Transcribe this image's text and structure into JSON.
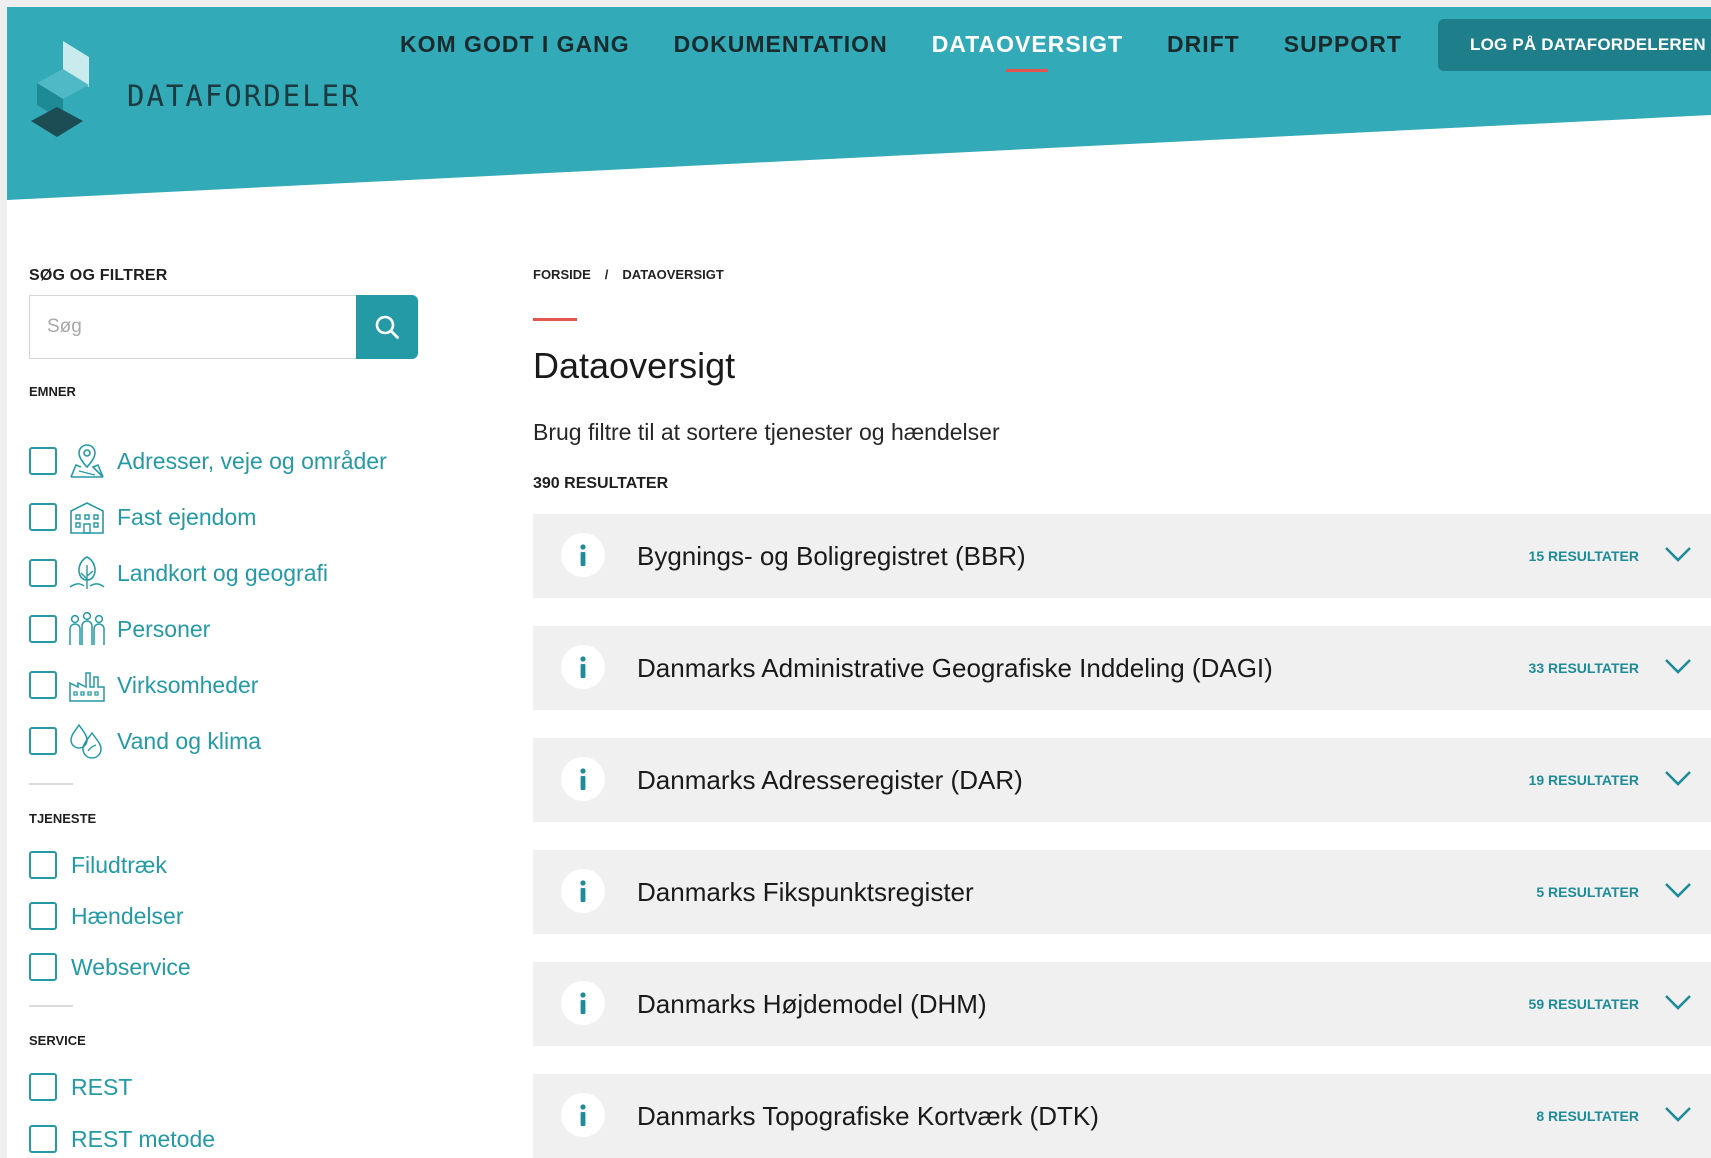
{
  "brand": {
    "name": "DATAFORDELER"
  },
  "nav": {
    "items": [
      {
        "label": "KOM GODT I GANG"
      },
      {
        "label": "DOKUMENTATION"
      },
      {
        "label": "DATAOVERSIGT"
      },
      {
        "label": "DRIFT"
      },
      {
        "label": "SUPPORT"
      }
    ],
    "active_index": 2,
    "login_label": "LOG PÅ DATAFORDELEREN"
  },
  "sidebar": {
    "heading": "SØG OG FILTRER",
    "search": {
      "placeholder": "Søg",
      "value": ""
    },
    "groups": {
      "emner": {
        "heading": "EMNER",
        "items": [
          {
            "label": "Adresser, veje og områder",
            "icon": "map-pin-icon"
          },
          {
            "label": "Fast ejendom",
            "icon": "building-icon"
          },
          {
            "label": "Landkort og geografi",
            "icon": "tree-landscape-icon"
          },
          {
            "label": "Personer",
            "icon": "people-icon"
          },
          {
            "label": "Virksomheder",
            "icon": "factory-icon"
          },
          {
            "label": "Vand og klima",
            "icon": "water-drop-icon"
          }
        ]
      },
      "tjeneste": {
        "heading": "TJENESTE",
        "items": [
          {
            "label": "Filudtræk"
          },
          {
            "label": "Hændelser"
          },
          {
            "label": "Webservice"
          }
        ]
      },
      "service": {
        "heading": "SERVICE",
        "items": [
          {
            "label": "REST"
          },
          {
            "label": "REST metode"
          }
        ]
      }
    }
  },
  "main": {
    "breadcrumb": [
      "FORSIDE",
      "/",
      "DATAOVERSIGT"
    ],
    "title": "Dataoversigt",
    "subtitle": "Brug filtre til at sortere tjenester og hændelser",
    "result_count": "390 RESULTATER",
    "registers": [
      {
        "title": "Bygnings- og Boligregistret (BBR)",
        "count": "15 RESULTATER"
      },
      {
        "title": "Danmarks Administrative Geografiske Inddeling (DAGI)",
        "count": "33 RESULTATER"
      },
      {
        "title": "Danmarks Adresseregister (DAR)",
        "count": "19 RESULTATER"
      },
      {
        "title": "Danmarks Fikspunktsregister",
        "count": "5 RESULTATER"
      },
      {
        "title": "Danmarks Højdemodel (DHM)",
        "count": "59 RESULTATER"
      },
      {
        "title": "Danmarks Topografiske Kortværk (DTK)",
        "count": "8 RESULTATER"
      }
    ]
  },
  "colors": {
    "header_teal": "#33aab8",
    "accent_teal": "#239aa5",
    "button_dark_teal": "#1e7f8b",
    "accent_red": "#e5554f",
    "row_bg": "#f0f0f0"
  }
}
